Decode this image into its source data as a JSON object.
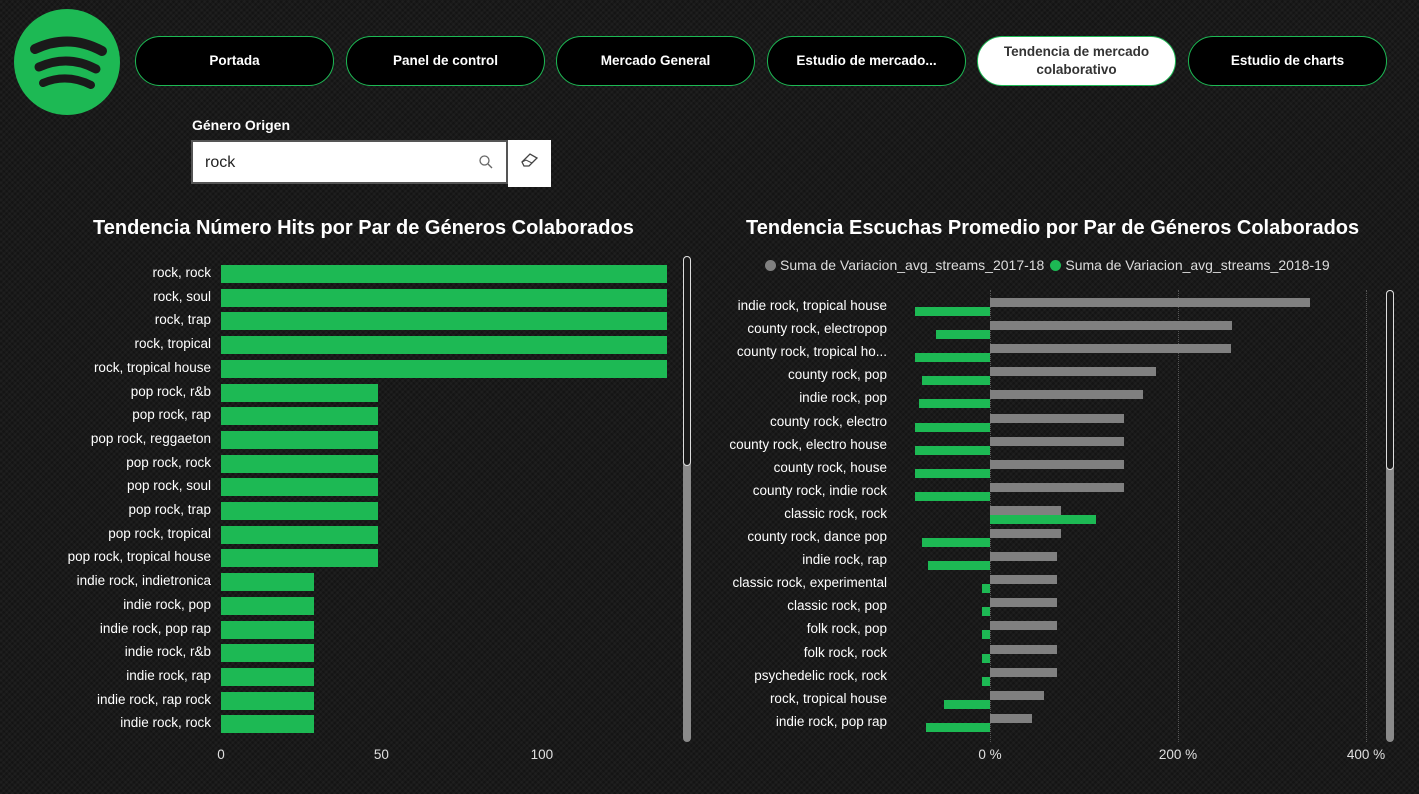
{
  "colors": {
    "accent": "#1db954",
    "gray_series": "#808080"
  },
  "logo": {
    "icon": "spotify-logo-icon"
  },
  "tabs": [
    {
      "label": "Portada",
      "active": false
    },
    {
      "label": "Panel de control",
      "active": false
    },
    {
      "label": "Mercado General",
      "active": false
    },
    {
      "label": "Estudio de mercado...",
      "active": false
    },
    {
      "label": "Tendencia de mercado colaborativo",
      "active": true
    },
    {
      "label": "Estudio de charts",
      "active": false
    }
  ],
  "filter": {
    "label": "Género Origen",
    "value": "rock",
    "search_icon": "search-icon",
    "clear_icon": "eraser-icon"
  },
  "chart_data": [
    {
      "type": "bar",
      "orientation": "horizontal",
      "title": "Tendencia Número Hits por Par de Géneros Colaborados",
      "categories": [
        "rock, rock",
        "rock, soul",
        "rock, trap",
        "rock, tropical",
        "rock, tropical house",
        "pop rock, r&b",
        "pop rock, rap",
        "pop rock, reggaeton",
        "pop rock, rock",
        "pop rock, soul",
        "pop rock, trap",
        "pop rock, tropical",
        "pop rock, tropical house",
        "indie rock, indietronica",
        "indie rock, pop",
        "indie rock, pop rap",
        "indie rock, r&b",
        "indie rock, rap",
        "indie rock, rap rock",
        "indie rock, rock"
      ],
      "values": [
        139,
        139,
        139,
        139,
        139,
        49,
        49,
        49,
        49,
        49,
        49,
        49,
        49,
        29,
        29,
        29,
        29,
        29,
        29,
        29
      ],
      "xticks": [
        "0",
        "50",
        "100"
      ],
      "xlim": [
        0,
        143
      ],
      "color": "#1db954"
    },
    {
      "type": "bar",
      "orientation": "horizontal",
      "title": "Tendencia Escuchas Promedio por Par de Géneros Colaborados",
      "categories": [
        "indie rock, tropical house",
        "county rock, electropop",
        "county rock, tropical ho...",
        "county rock, pop",
        "indie rock, pop",
        "county rock, electro",
        "county rock, electro house",
        "county rock, house",
        "county rock, indie rock",
        "classic rock, rock",
        "county rock, dance pop",
        "indie rock, rap",
        "classic rock, experimental",
        "classic rock, pop",
        "folk rock, pop",
        "folk rock, rock",
        "psychedelic rock, rock",
        "rock, tropical house",
        "indie rock, pop rap"
      ],
      "series": [
        {
          "name": "Suma de Variacion_avg_streams_2017-18",
          "color": "#808080",
          "values": [
            340,
            257,
            256,
            177,
            163,
            143,
            143,
            143,
            143,
            76,
            75,
            71,
            71,
            71,
            71,
            71,
            71,
            57,
            45
          ]
        },
        {
          "name": "Suma de Variacion_avg_streams_2018-19",
          "color": "#1db954",
          "values": [
            -80,
            -57,
            -80,
            -72,
            -76,
            -80,
            -80,
            -80,
            -80,
            113,
            -72,
            -66,
            -8,
            -8,
            -8,
            -8,
            -8,
            -49,
            -68
          ]
        }
      ],
      "xticks": [
        "0 %",
        "200 %",
        "400 %"
      ],
      "xlim": [
        -80,
        420
      ],
      "unit": "%"
    }
  ]
}
